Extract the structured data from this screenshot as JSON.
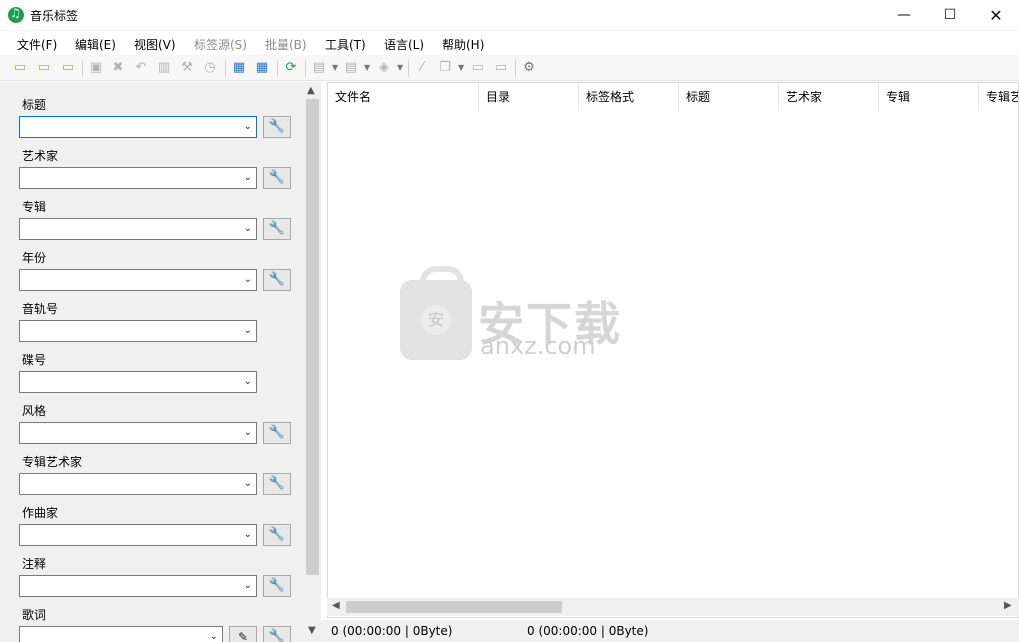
{
  "window": {
    "title": "音乐标签",
    "minimize_glyph": "—",
    "maximize_glyph": "☐",
    "close_glyph": "✕"
  },
  "menu": [
    {
      "label": "文件(F)",
      "enabled": true
    },
    {
      "label": "编辑(E)",
      "enabled": true
    },
    {
      "label": "视图(V)",
      "enabled": true
    },
    {
      "label": "标签源(S)",
      "enabled": false
    },
    {
      "label": "批量(B)",
      "enabled": false
    },
    {
      "label": "工具(T)",
      "enabled": true
    },
    {
      "label": "语言(L)",
      "enabled": true
    },
    {
      "label": "帮助(H)",
      "enabled": true
    }
  ],
  "toolbar": {
    "icons": [
      "open-folder-icon",
      "add-folder-icon",
      "open-subfolders-icon",
      "save-icon",
      "remove-icon",
      "undo-icon",
      "book-icon",
      "wrench-icon",
      "history-icon",
      "grid-view-icon",
      "table-view-icon",
      "refresh-icon",
      "cover-icon",
      "abc-icon",
      "tag-icon",
      "magic-wand-icon",
      "copy-icon",
      "move-icon",
      "rename-icon",
      "settings-icon"
    ]
  },
  "fields": [
    {
      "label": "标题",
      "value": "",
      "has_tool": true,
      "focused": true
    },
    {
      "label": "艺术家",
      "value": "",
      "has_tool": true
    },
    {
      "label": "专辑",
      "value": "",
      "has_tool": true
    },
    {
      "label": "年份",
      "value": "",
      "has_tool": true
    },
    {
      "label": "音轨号",
      "value": "",
      "has_tool": false
    },
    {
      "label": "碟号",
      "value": "",
      "has_tool": false
    },
    {
      "label": "风格",
      "value": "",
      "has_tool": true
    },
    {
      "label": "专辑艺术家",
      "value": "",
      "has_tool": true
    },
    {
      "label": "作曲家",
      "value": "",
      "has_tool": true
    },
    {
      "label": "注释",
      "value": "",
      "has_tool": true
    },
    {
      "label": "歌词",
      "value": "",
      "has_tool": true
    }
  ],
  "columns": [
    "文件名",
    "目录",
    "标签格式",
    "标题",
    "艺术家",
    "专辑",
    "专辑艺术家"
  ],
  "watermark": {
    "brand_cn": "安下载",
    "brand_en": "anxz.com",
    "shield_glyph": "安"
  },
  "status": {
    "left": "0 (00:00:00 | 0Byte)",
    "right": "0 (00:00:00 | 0Byte)"
  },
  "glyphs": {
    "caret": "⌄",
    "wrench": "🔧",
    "edit": "✎",
    "up": "▲",
    "down": "▼",
    "left": "◀",
    "right": "▶"
  }
}
